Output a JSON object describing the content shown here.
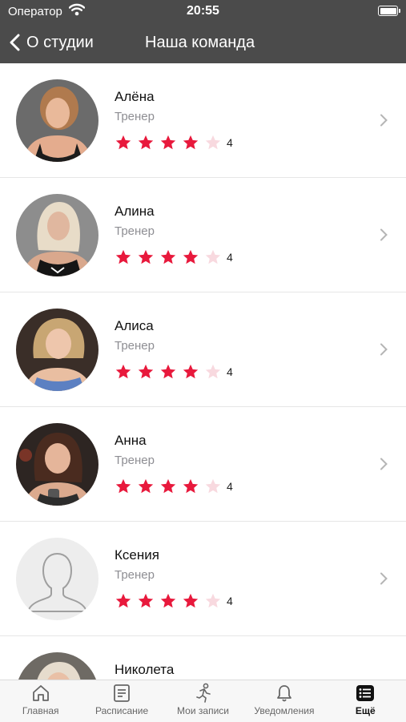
{
  "status_bar": {
    "carrier": "Оператор",
    "time": "20:55"
  },
  "nav": {
    "back_label": "О студии",
    "title": "Наша команда"
  },
  "trainers": [
    {
      "name": "Алёна",
      "role": "Тренер",
      "rating": 4,
      "rating_label": "4"
    },
    {
      "name": "Алина",
      "role": "Тренер",
      "rating": 4,
      "rating_label": "4"
    },
    {
      "name": "Алиса",
      "role": "Тренер",
      "rating": 4,
      "rating_label": "4"
    },
    {
      "name": "Анна",
      "role": "Тренер",
      "rating": 4,
      "rating_label": "4"
    },
    {
      "name": "Ксения",
      "role": "Тренер",
      "rating": 4,
      "rating_label": "4"
    },
    {
      "name": "Николета"
    }
  ],
  "tabbar": {
    "items": [
      {
        "label": "Главная",
        "icon": "home-icon"
      },
      {
        "label": "Расписание",
        "icon": "schedule-icon"
      },
      {
        "label": "Мои записи",
        "icon": "running-person-icon"
      },
      {
        "label": "Уведомления",
        "icon": "bell-icon"
      },
      {
        "label": "Ещё",
        "icon": "list-icon",
        "active": true
      }
    ]
  },
  "colors": {
    "header": "#4b4b4b",
    "star_on": "#e8193c",
    "star_off": "#f8d9df"
  }
}
